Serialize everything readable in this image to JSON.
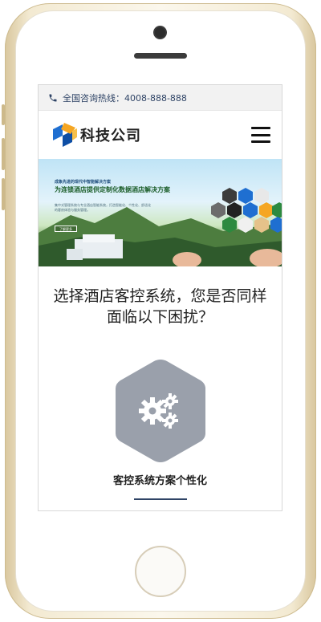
{
  "topbar": {
    "hotline_label": "全国咨询热线：4008-888-888"
  },
  "header": {
    "logo_text": "科技公司",
    "menu_icon": "hamburger-menu-icon"
  },
  "banner": {
    "small_text": "成象先进的现代中智能解决方案",
    "headline": "为连锁酒店提供定制化数据酒店解决方案",
    "description": "集中式管理系统与专业酒店智能系统，打造智能化、个性化、舒适化的客房体验与服务管理。",
    "button_label": "了解更多"
  },
  "section": {
    "title": "选择酒店客控系统，您是否同样面临以下困扰？",
    "feature_icon": "gears-icon",
    "feature_label": "客控系统方案个性化"
  },
  "colors": {
    "accent": "#2f4466",
    "hex_bg": "#9aa0ab",
    "logo_blue": "#1f6fd1",
    "logo_orange": "#f5a623"
  }
}
